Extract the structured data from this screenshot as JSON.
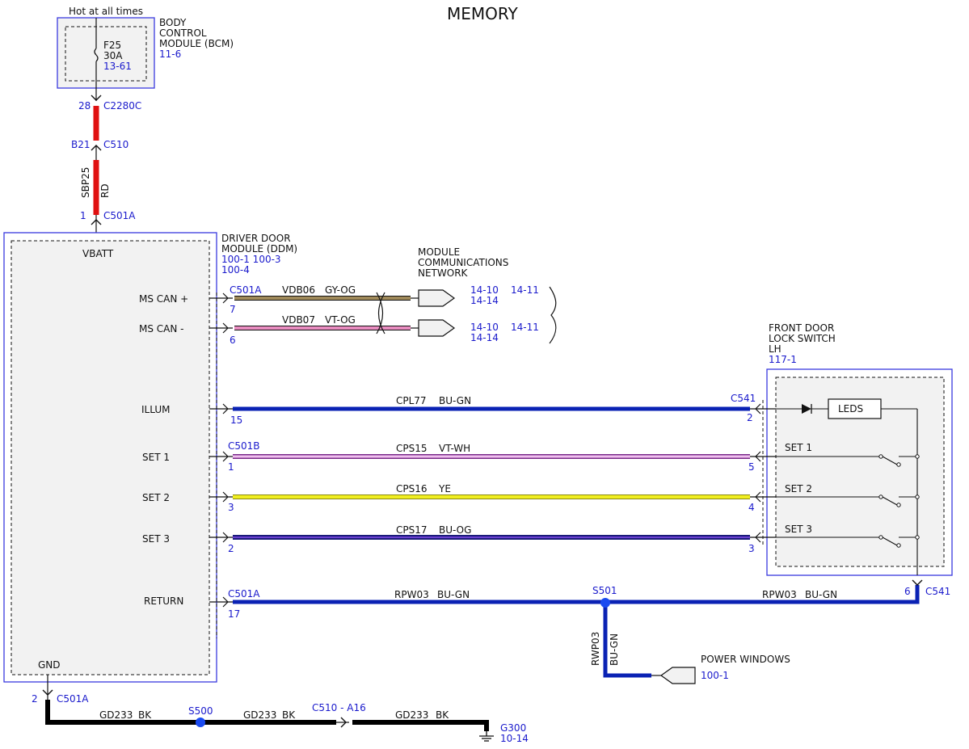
{
  "title": "MEMORY",
  "bcm": {
    "hot_label": "Hot at all times",
    "name1": "BODY",
    "name2": "CONTROL",
    "name3": "MODULE (BCM)",
    "ref": "11-6",
    "fuse_id": "F25",
    "fuse_amp": "30A",
    "fuse_ref": "13-61"
  },
  "feed": {
    "pin_c2280c": "28",
    "conn_c2280c": "C2280C",
    "pin_c510": "B21",
    "conn_c510": "C510",
    "circuit": "SBP25",
    "color": "RD",
    "pin_c501a": "1",
    "conn_c501a": "C501A"
  },
  "ddm": {
    "name1": "DRIVER DOOR",
    "name2": "MODULE (DDM)",
    "ref1": "100-1 100-3",
    "ref2": "100-4",
    "vbatt": "VBATT",
    "gnd": "GND",
    "pins": {
      "ms_can_plus": "MS CAN +",
      "ms_can_minus": "MS CAN -",
      "illum": "ILLUM",
      "set1": "SET 1",
      "set2": "SET 2",
      "set3": "SET 3",
      "return": "RETURN"
    }
  },
  "network": {
    "name1": "MODULE",
    "name2": "COMMUNICATIONS",
    "name3": "NETWORK",
    "can_plus": {
      "conn": "C501A",
      "pin": "7",
      "circuit": "VDB06",
      "color": "GY-OG",
      "ref_a": "14-10",
      "ref_b": "14-11",
      "ref_c": "14-14"
    },
    "can_minus": {
      "pin": "6",
      "circuit": "VDB07",
      "color": "VT-OG",
      "ref_a": "14-10",
      "ref_b": "14-11",
      "ref_c": "14-14"
    }
  },
  "switch": {
    "name1": "FRONT DOOR",
    "name2": "LOCK SWITCH",
    "name3": "LH",
    "ref": "117-1",
    "leds": "LEDS",
    "set1": "SET 1",
    "set2": "SET 2",
    "set3": "SET 3",
    "conn_top": "C541",
    "conn_bottom": "C541",
    "pin_bottom": "6"
  },
  "wires": {
    "illum": {
      "pin_left": "15",
      "circuit": "CPL77",
      "color": "BU-GN",
      "pin_right": "2"
    },
    "set1": {
      "conn": "C501B",
      "pin_left": "1",
      "circuit": "CPS15",
      "color": "VT-WH",
      "pin_right": "5"
    },
    "set2": {
      "pin_left": "3",
      "circuit": "CPS16",
      "color": "YE",
      "pin_right": "4"
    },
    "set3": {
      "pin_left": "2",
      "circuit": "CPS17",
      "color": "BU-OG",
      "pin_right": "3"
    },
    "return": {
      "conn": "C501A",
      "pin_left": "17",
      "circuit_left": "RPW03",
      "color_left": "BU-GN",
      "splice": "S501",
      "circuit_right": "RPW03",
      "color_right": "BU-GN",
      "branch_circuit": "RWP03",
      "branch_color": "BU-GN"
    }
  },
  "power_windows": {
    "name": "POWER WINDOWS",
    "ref": "100-1"
  },
  "ground": {
    "pin": "2",
    "conn": "C501A",
    "circuit1": "GD233",
    "color1": "BK",
    "splice": "S500",
    "circuit2": "GD233",
    "color2": "BK",
    "inline": "C510 - A16",
    "circuit3": "GD233",
    "color3": "BK",
    "g_id": "G300",
    "g_ref": "10-14"
  },
  "colors": {
    "ink": "#111111",
    "ref_blue": "#1a1acc",
    "module_border": "#3a3adf",
    "module_fill": "#f2f2f2",
    "rd": "#e01010",
    "gy_og": "#a08a5a",
    "vt_og": "#e98cc0",
    "bu_gn": "#0a22b4",
    "vt_wh": "#e8a0e0",
    "ye": "#f0ee20",
    "bu_og": "#2a20a8",
    "bk": "#000000"
  }
}
